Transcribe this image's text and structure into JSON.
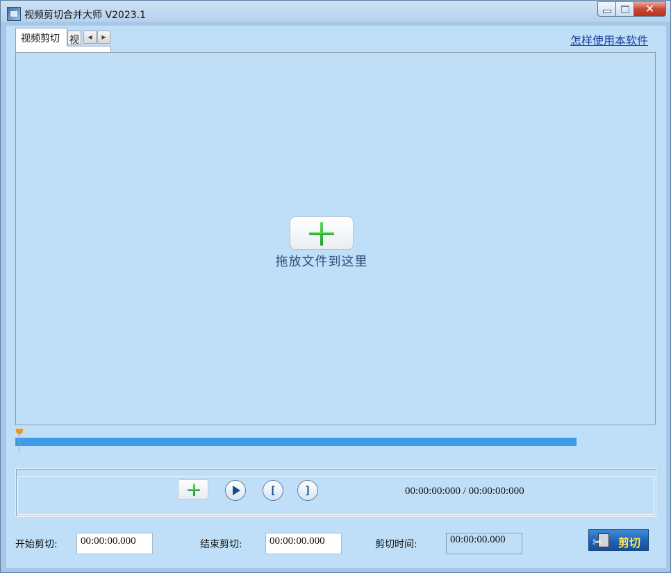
{
  "window": {
    "title": "视频剪切合并大师 V2023.1",
    "close_glyph": "✕"
  },
  "tabs": {
    "active_label": "视频剪切",
    "inactive_label": "视",
    "scroll_left": "◀",
    "scroll_right": "▶"
  },
  "help_link": "怎样使用本软件",
  "dropzone": {
    "text": "拖放文件到这里"
  },
  "controls": {
    "time_display": "00:00:00:000 / 00:00:00:000",
    "mark_in": "[",
    "mark_out": "]"
  },
  "cut_settings": {
    "start_label": "开始剪切:",
    "start_value": "00:00:00.000",
    "end_label": "结束剪切:",
    "end_value": "00:00:00.000",
    "duration_label": "剪切时间:",
    "duration_value": "00:00:00.000",
    "cut_button_label": "剪切"
  },
  "colors": {
    "client_bg": "#bfdff8",
    "timeline_track": "#3f9be8",
    "playhead": "#f0961e",
    "link": "#1b3fa0"
  },
  "icons": [
    "app-icon",
    "minimize-icon",
    "maximize-icon",
    "close-icon",
    "add-file-icon",
    "play-icon",
    "mark-in-icon",
    "mark-out-icon",
    "scissors-film-icon"
  ]
}
